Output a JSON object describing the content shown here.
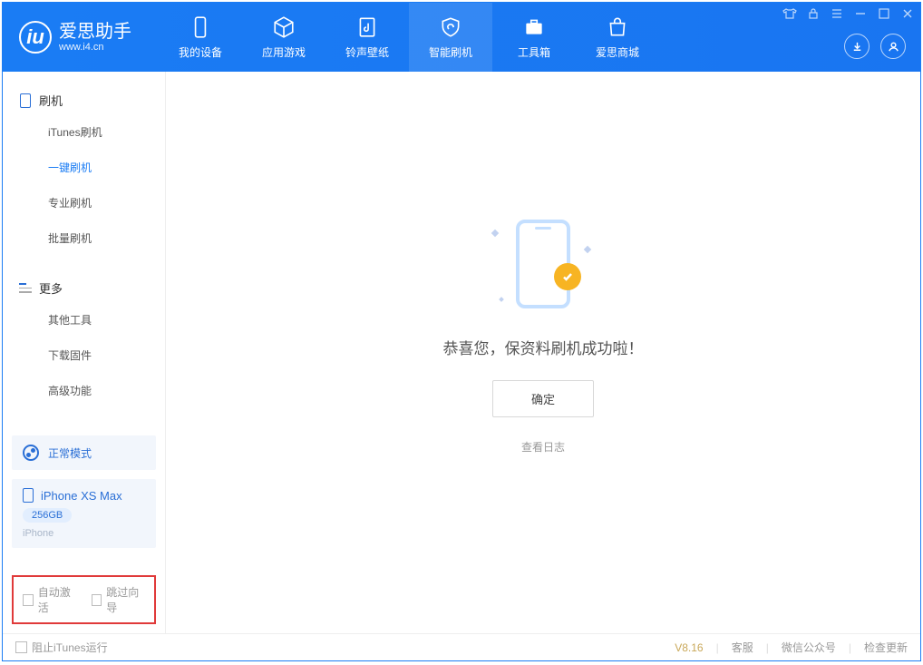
{
  "logo": {
    "main": "爱思助手",
    "sub": "www.i4.cn"
  },
  "nav": {
    "items": [
      {
        "label": "我的设备"
      },
      {
        "label": "应用游戏"
      },
      {
        "label": "铃声壁纸"
      },
      {
        "label": "智能刷机"
      },
      {
        "label": "工具箱"
      },
      {
        "label": "爱思商城"
      }
    ]
  },
  "sidebar": {
    "flash_section": "刷机",
    "flash_items": [
      "iTunes刷机",
      "一键刷机",
      "专业刷机",
      "批量刷机"
    ],
    "more_section": "更多",
    "more_items": [
      "其他工具",
      "下载固件",
      "高级功能"
    ]
  },
  "device": {
    "status": "正常模式",
    "name": "iPhone XS Max",
    "storage": "256GB",
    "type": "iPhone"
  },
  "options": {
    "auto_activate": "自动激活",
    "skip_guide": "跳过向导"
  },
  "main": {
    "success_title": "恭喜您，保资料刷机成功啦！",
    "confirm": "确定",
    "view_log": "查看日志"
  },
  "footer": {
    "block_itunes": "阻止iTunes运行",
    "version": "V8.16",
    "support": "客服",
    "wechat": "微信公众号",
    "update": "检查更新"
  }
}
